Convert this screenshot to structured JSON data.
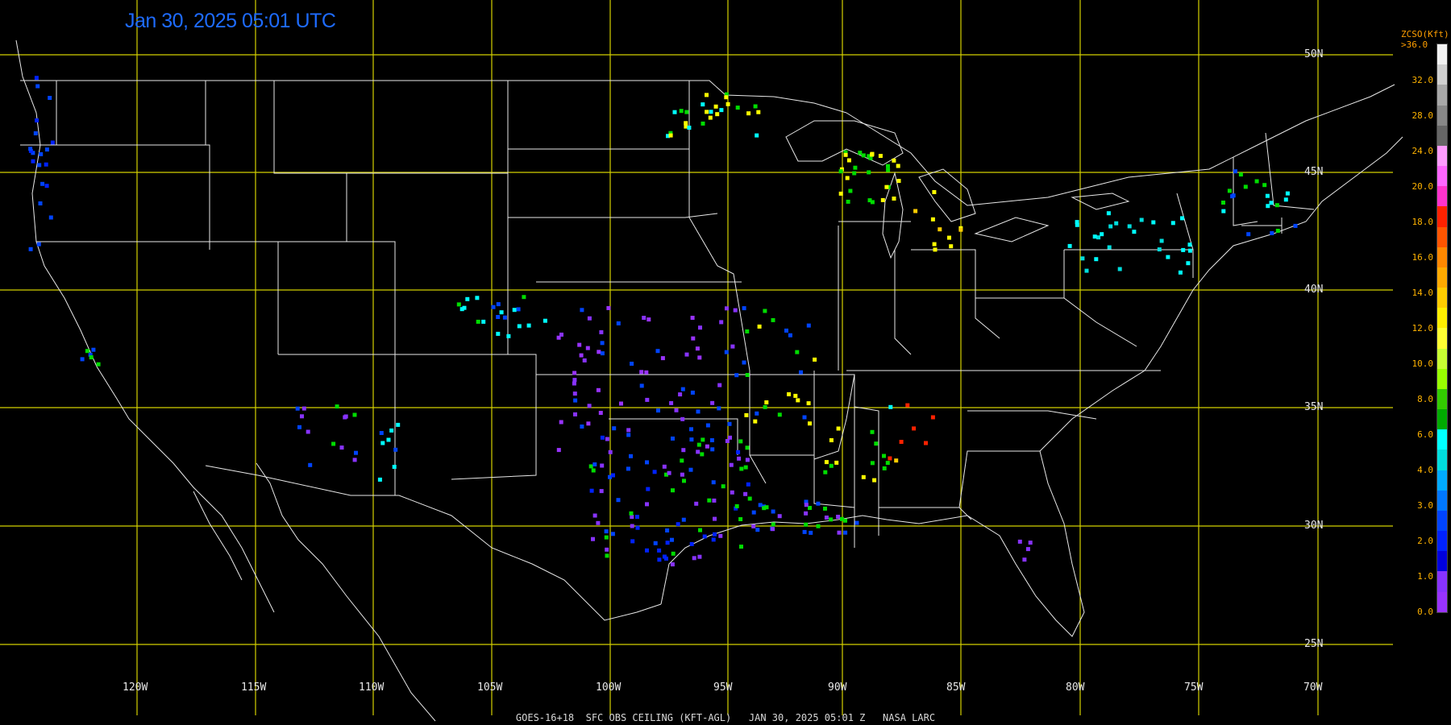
{
  "title": "Jan 30, 2025 05:01 UTC",
  "footer": "GOES-16+18  SFC OBS CEILING (KFT-AGL)   JAN 30, 2025 05:01 Z   NASA LARC",
  "longitude_labels": [
    "120W",
    "115W",
    "110W",
    "105W",
    "100W",
    "95W",
    "90W",
    "85W",
    "80W",
    "75W",
    "70W"
  ],
  "latitude_labels": [
    "50N",
    "45N",
    "40N",
    "35N",
    "30N",
    "25N"
  ],
  "legend": {
    "title_line1": "ZCSO(Kft)",
    "title_line2": ">36.0",
    "ticks": [
      "32.0",
      "28.0",
      "24.0",
      "20.0",
      "18.0",
      "16.0",
      "14.0",
      "12.0",
      "10.0",
      "8.0",
      "6.0",
      "4.0",
      "3.0",
      "2.0",
      "1.0",
      "0.0"
    ],
    "colors_top_to_bottom": [
      "#f2f2f2",
      "#d0d0d0",
      "#a8a8a8",
      "#888888",
      "#666666",
      "#ff9cff",
      "#ff66ff",
      "#ff33cc",
      "#ff2200",
      "#ff5500",
      "#ff8800",
      "#ffaa00",
      "#ffcc00",
      "#ffee00",
      "#ffff33",
      "#c8ff33",
      "#99ff00",
      "#33cc00",
      "#00aa00",
      "#00ffff",
      "#00dddd",
      "#00aaff",
      "#0077ff",
      "#0044ff",
      "#0022ff",
      "#0000dd",
      "#8833ff",
      "#9933ff"
    ]
  },
  "colors": {
    "grid": "#d4d000",
    "borders": "#e8e8e8",
    "title": "#1e6bff"
  }
}
